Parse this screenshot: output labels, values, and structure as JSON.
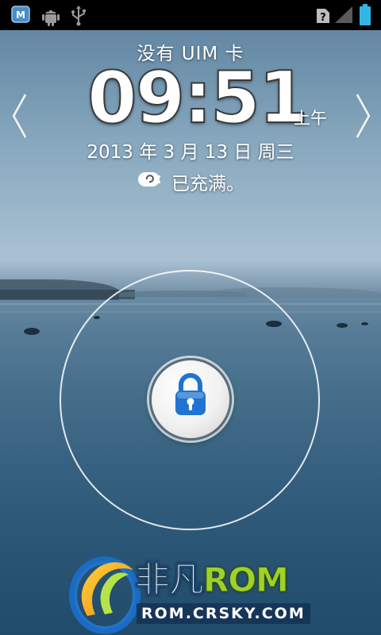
{
  "status_bar": {
    "left_icons": [
      "mmsf-app-icon",
      "android-debug-icon",
      "usb-icon"
    ],
    "right_icons": [
      "sim-unknown-icon",
      "signal-icon",
      "battery-full-icon"
    ]
  },
  "lockscreen": {
    "carrier": "没有 UIM 卡",
    "time": "09:51",
    "ampm": "上午",
    "date": "2013 年 3 月 13 日 周三",
    "battery_status": "已充满。"
  },
  "watermark": {
    "brand_cn": "非凡",
    "brand_rom": "ROM",
    "url": "ROM.CRSKY.COM"
  },
  "colors": {
    "status_bar_bg": "#000000",
    "lock_blue": "#1f74d1",
    "battery_green": "#4fc3f7"
  }
}
